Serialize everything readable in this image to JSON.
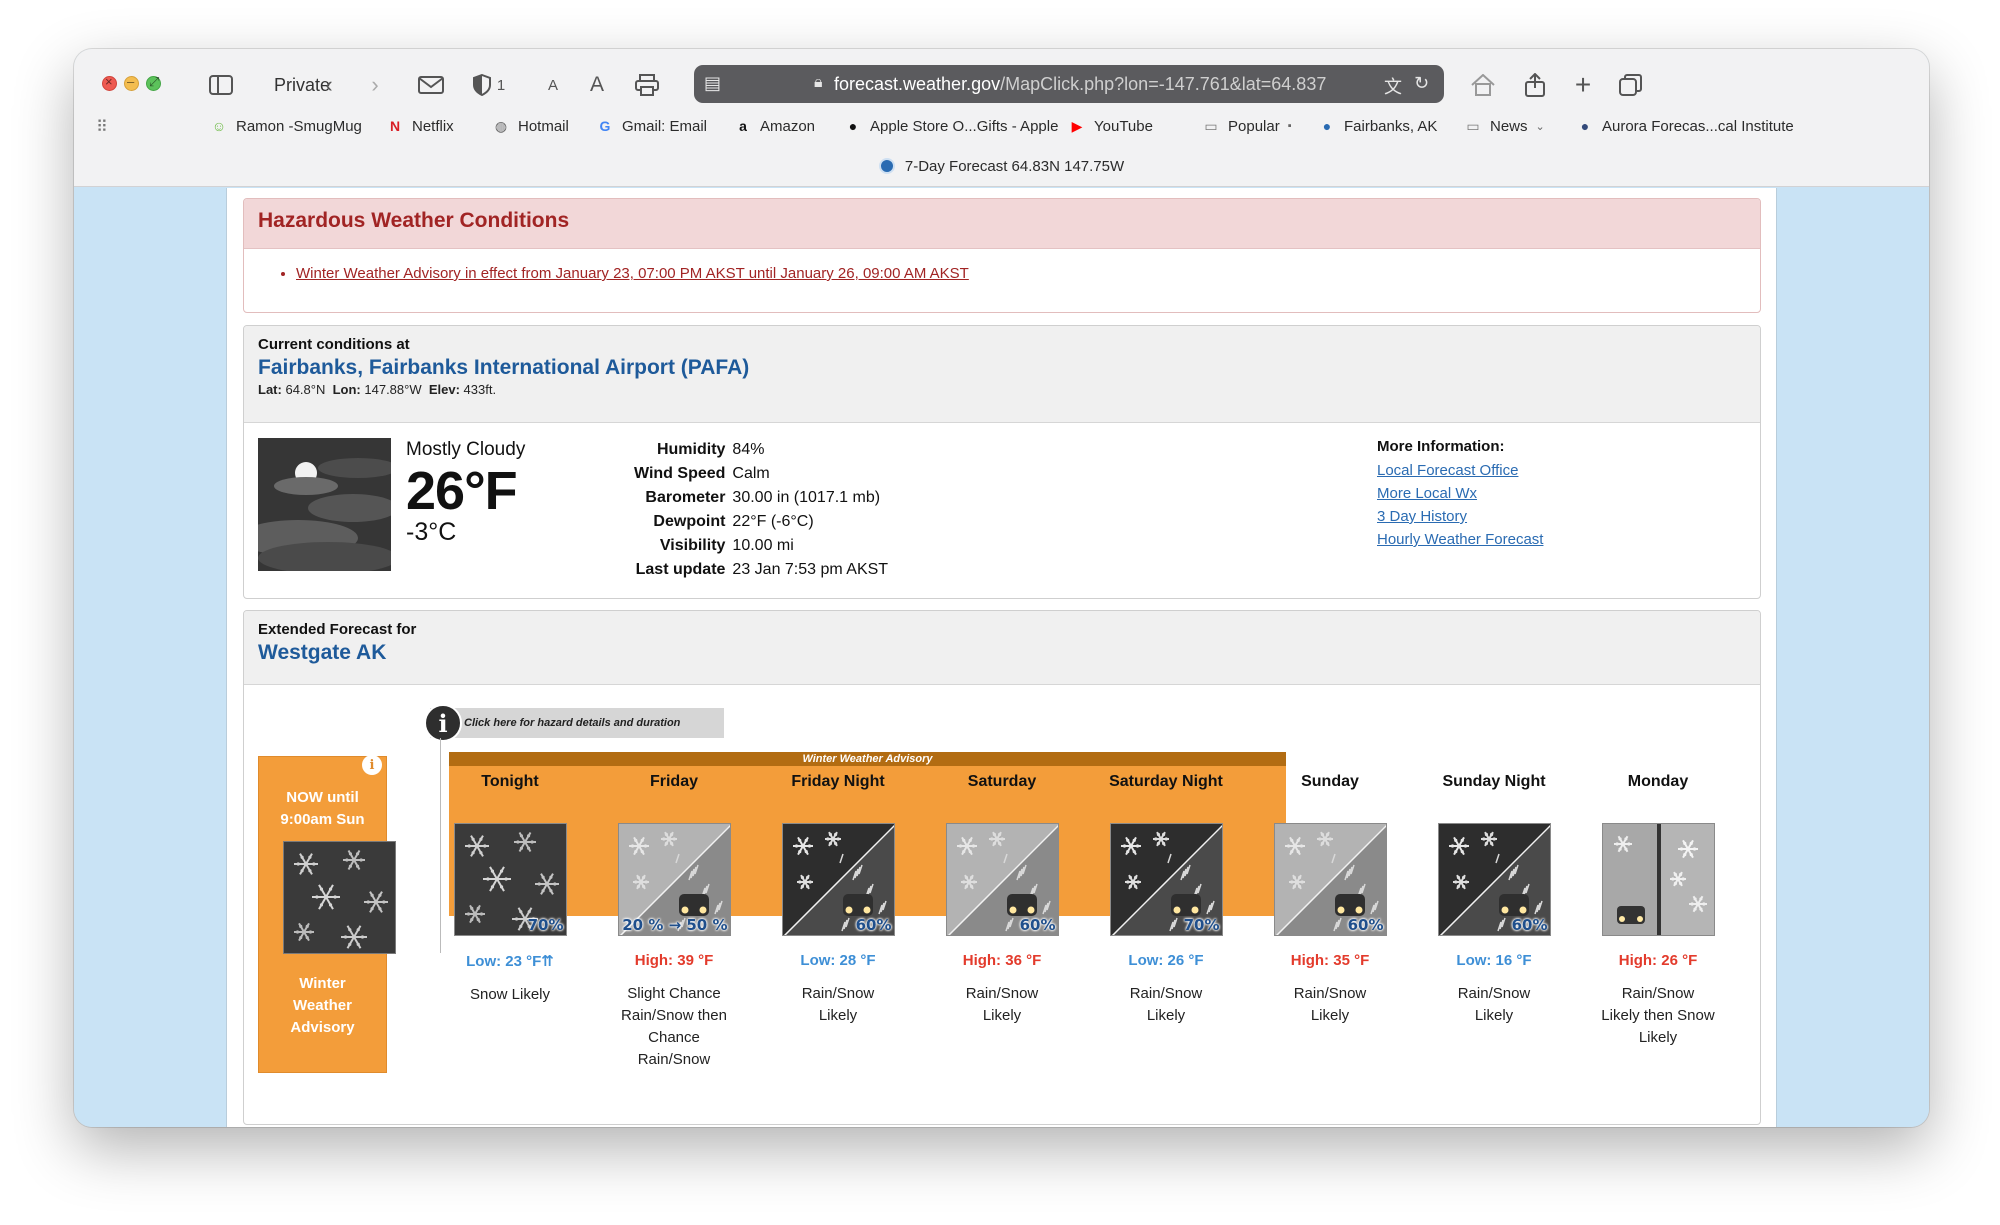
{
  "browser": {
    "private_label": "Private",
    "url_host": "forecast.weather.gov",
    "url_path": "/MapClick.php?lon=-147.761&lat=64.837",
    "shield_count": "1",
    "text_small": "A",
    "text_large": "A",
    "tab_title": "7-Day Forecast 64.83N 147.75W"
  },
  "bookmarks": [
    {
      "label": "Ramon -SmugMug",
      "icon": "smugmug-icon",
      "color": "#6dbb45"
    },
    {
      "label": "Netflix",
      "icon": "netflix-icon",
      "color": "#d81f26"
    },
    {
      "label": "Hotmail",
      "icon": "globe-icon",
      "color": "#666666"
    },
    {
      "label": "Gmail: Email",
      "icon": "google-icon",
      "color": "#4285f4"
    },
    {
      "label": "Amazon",
      "icon": "amazon-icon",
      "color": "#111111"
    },
    {
      "label": "Apple Store O...Gifts - Apple",
      "icon": "apple-icon",
      "color": "#111111"
    },
    {
      "label": "YouTube",
      "icon": "youtube-icon",
      "color": "#ff0000"
    },
    {
      "label": "Popular",
      "icon": "folder-icon",
      "color": "#777777"
    },
    {
      "label": "Fairbanks, AK",
      "icon": "noaa-icon",
      "color": "#2a6bb2"
    },
    {
      "label": "News",
      "icon": "folder-icon",
      "color": "#777777"
    },
    {
      "label": "Aurora Forecas...cal Institute",
      "icon": "aurora-icon",
      "color": "#334a7a"
    }
  ],
  "hazard": {
    "title": "Hazardous Weather Conditions",
    "link": "Winter Weather Advisory in effect from January 23, 07:00 PM AKST until January 26, 09:00 AM AKST"
  },
  "current": {
    "label": "Current conditions at",
    "station": "Fairbanks, Fairbanks International Airport (PAFA)",
    "lat_label": "Lat:",
    "lat": "64.8°N",
    "lon_label": "Lon:",
    "lon": "147.88°W",
    "elev_label": "Elev:",
    "elev": "433ft.",
    "condition": "Mostly Cloudy",
    "temp_f": "26°F",
    "temp_c": "-3°C",
    "details": [
      {
        "k": "Humidity",
        "v": "84%"
      },
      {
        "k": "Wind Speed",
        "v": "Calm"
      },
      {
        "k": "Barometer",
        "v": "30.00 in (1017.1 mb)"
      },
      {
        "k": "Dewpoint",
        "v": "22°F (-6°C)"
      },
      {
        "k": "Visibility",
        "v": "10.00 mi"
      },
      {
        "k": "Last update",
        "v": "23 Jan 7:53 pm AKST"
      }
    ],
    "more_info_title": "More Information:",
    "more_info_links": [
      "Local Forecast Office",
      "More Local Wx",
      "3 Day History",
      "Hourly Weather Forecast"
    ]
  },
  "extended": {
    "label": "Extended Forecast for",
    "place": "Westgate AK",
    "hazard_tip": "Click here for hazard details and duration",
    "now_text": "NOW until 9:00am Sun",
    "now_label": "Winter Weather Advisory",
    "advisory_band": "Winter Weather Advisory",
    "periods": [
      {
        "name": "Tonight",
        "pop": "70%",
        "temp": "Low: 23 °F⇈",
        "type": "low",
        "desc": "Snow Likely",
        "img": "snow-dark"
      },
      {
        "name": "Friday",
        "pop": "20 % → 50 %",
        "temp": "High: 39 °F",
        "type": "high",
        "desc": "Slight Chance Rain/Snow then Chance Rain/Snow",
        "img": "rainsnow-light"
      },
      {
        "name": "Friday Night",
        "pop": "60%",
        "temp": "Low: 28 °F",
        "type": "low",
        "desc": "Rain/Snow Likely",
        "img": "rainsnow-dark"
      },
      {
        "name": "Saturday",
        "pop": "60%",
        "temp": "High: 36 °F",
        "type": "high",
        "desc": "Rain/Snow Likely",
        "img": "rainsnow-light"
      },
      {
        "name": "Saturday Night",
        "pop": "70%",
        "temp": "Low: 26 °F",
        "type": "low",
        "desc": "Rain/Snow Likely",
        "img": "rainsnow-dark"
      },
      {
        "name": "Sunday",
        "pop": "60%",
        "temp": "High: 35 °F",
        "type": "high",
        "desc": "Rain/Snow Likely",
        "img": "rainsnow-light"
      },
      {
        "name": "Sunday Night",
        "pop": "60%",
        "temp": "Low: 16 °F",
        "type": "low",
        "desc": "Rain/Snow Likely",
        "img": "rainsnow-dark"
      },
      {
        "name": "Monday",
        "pop": "",
        "temp": "High: 26 °F",
        "type": "high",
        "desc": "Rain/Snow Likely then Snow Likely",
        "img": "split-light"
      }
    ]
  }
}
